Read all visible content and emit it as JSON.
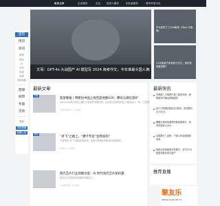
{
  "topnav": {
    "tabs": [
      {
        "label": "聚焦品牌",
        "active": true
      },
      {
        "label": "企业服务",
        "active": false
      },
      {
        "label": "企业",
        "active": false
      },
      {
        "label": "投资人服务",
        "active": false
      },
      {
        "label": "创业者服务",
        "active": false
      },
      {
        "label": "城市开放平台",
        "active": false
      }
    ]
  },
  "sidebar": {
    "items": [
      {
        "label": "首页",
        "active": true
      },
      {
        "label": "快讯",
        "active": false
      },
      {
        "label": "资讯",
        "active": false
      },
      {
        "label": "推荐",
        "small": true
      },
      {
        "label": "财经",
        "small": true
      },
      {
        "label": "AI",
        "small": true
      },
      {
        "label": "汽车",
        "small": true
      },
      {
        "label": "科技",
        "small": true
      },
      {
        "label": "消费",
        "small": true
      },
      {
        "label": "专精特新",
        "small": true
      },
      {
        "label": "直播",
        "active": false
      },
      {
        "label": "视频",
        "active": false
      },
      {
        "label": "专题",
        "active": false
      },
      {
        "label": "活动",
        "active": false
      },
      {
        "label": "搜索",
        "active": false
      }
    ],
    "buttons": [
      "寻求报道",
      "我要入驻"
    ]
  },
  "hero": {
    "title": "文哥：GPT-4o 大战国产 AI 模型写 2024 高考作文，今年谁最令国人满意..."
  },
  "thumbs": [
    {
      "caption": "华为发布了三大AI新品（Mate 平板等）"
    },
    {
      "caption": "11月各家汽车新势力交付，谁的表现最亮眼？"
    }
  ],
  "latest": {
    "title": "最新文章",
    "items": [
      {
        "tag": "科技",
        "headline": "氪星晚报 | 特斯拉中国上线百度地图V20；腾讯与微信保护",
        "desc": "Stellantis表示将在中国扩大零部件采购比例；比亚迪方舟秀和伴生已接连运行一年；广发银行战略合作伙伴...",
        "meta": "36氪的朋友们 · 2小时前"
      },
      {
        "tag": "财经",
        "headline": "“孝飞”之路上，“爆卡专卖”生死如何？",
        "desc": "不是所有“孝飞”都能变现利润，而是只有做好网络效应和规模化...",
        "meta": "投资家 · 2小时前"
      },
      {
        "tag": "",
        "headline": "稳元芯片行业洞察文案：AI 时代领元芯片新机遇",
        "desc": "稳元芯片在智能化浪潮中持续发力...",
        "meta": "36氪研究院 · 3小时前"
      }
    ]
  },
  "fast": {
    "title": "最新快讯",
    "items": [
      "中概股三大指数午盘三股变体涨，美联储年内降息预期维持",
      "伟门2号国际基金设立新设，投资额约达10亿元",
      "麒麟天逸科技股票的基金推荐中，协同改造拟以近似",
      "全国累计三连跌，宁德公布全国国家用电",
      "智能手机首届现代发展方，京东方5G配套测算完成中国产"
    ]
  },
  "recommend": {
    "title": "推荐直播"
  },
  "watermark": {
    "big": "聚友乐",
    "small": "www.juyoule.cn"
  }
}
